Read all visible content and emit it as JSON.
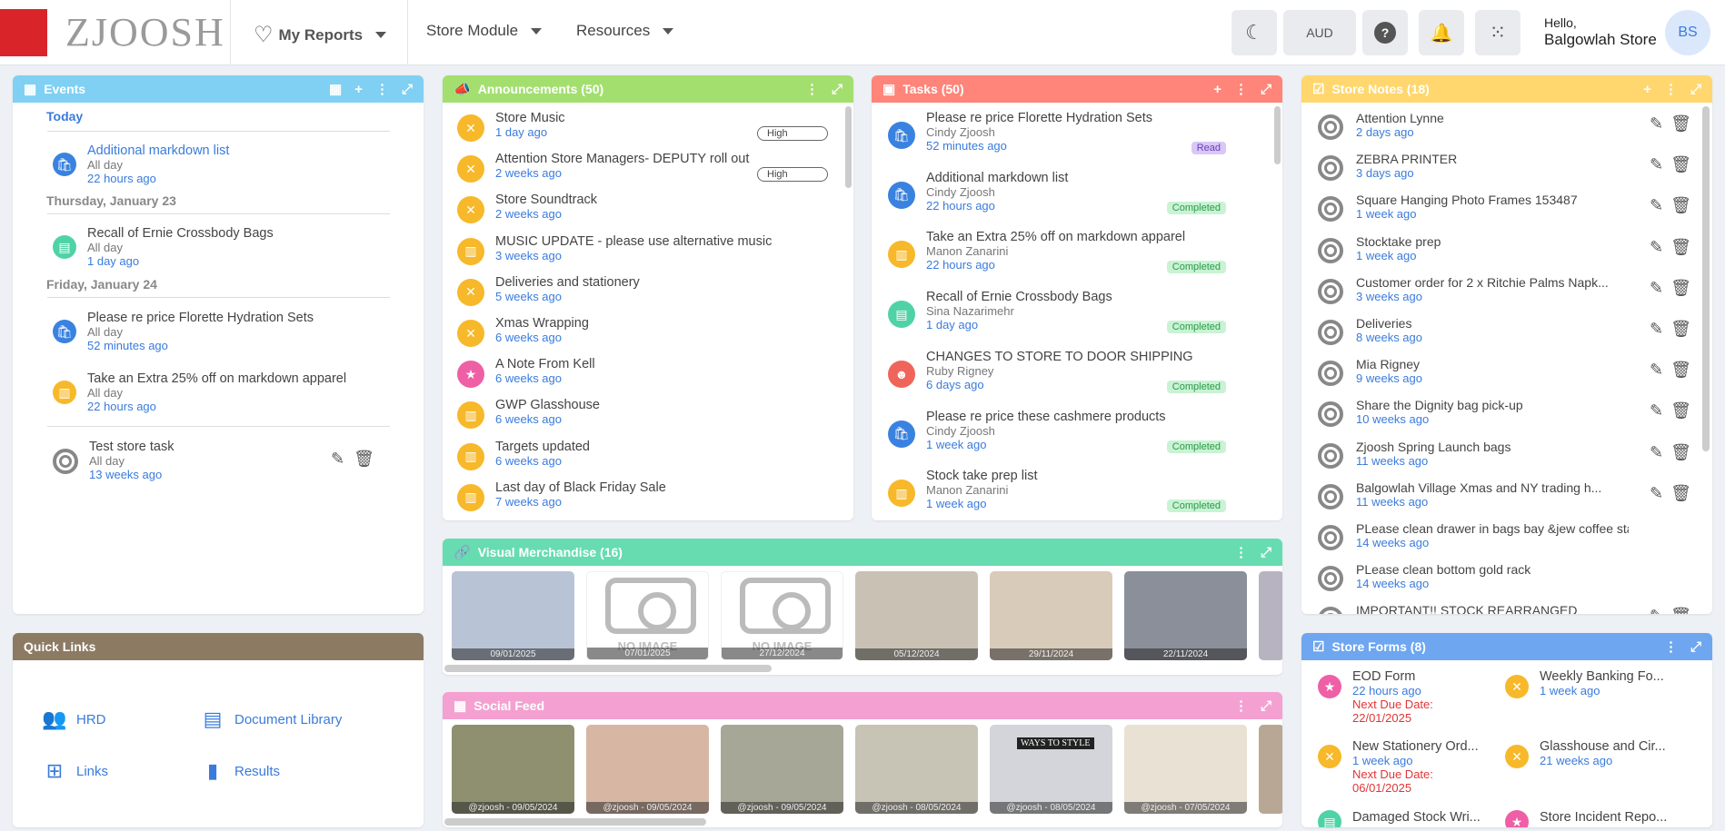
{
  "brand": {
    "name": "ZJOOSH",
    "logo_color": "#d9252a"
  },
  "nav": {
    "my_reports": "My Reports",
    "store_module": "Store Module",
    "resources": "Resources"
  },
  "toolbar": {
    "currency": "AUD"
  },
  "user": {
    "greeting": "Hello,",
    "store": "Balgowlah Store",
    "initials": "BS"
  },
  "events": {
    "title": "Events",
    "groups": [
      {
        "label": "Today",
        "items": [
          {
            "title": "Additional markdown list",
            "sub": "All day",
            "time": "22 hours ago"
          }
        ]
      },
      {
        "label": "Thursday, January 23",
        "items": [
          {
            "title": "Recall of Ernie Crossbody Bags",
            "sub": "All day",
            "time": "1 day ago"
          }
        ]
      },
      {
        "label": "Friday, January 24",
        "items": [
          {
            "title": "Please re price Florette Hydration Sets",
            "sub": "All day",
            "time": "52 minutes ago"
          },
          {
            "title": "Take an Extra 25% off on markdown apparel",
            "sub": "All day",
            "time": "22 hours ago"
          }
        ]
      }
    ],
    "task": {
      "title": "Test store task",
      "sub": "All day",
      "time": "13 weeks ago"
    }
  },
  "announcements": {
    "title": "Announcements (50)",
    "items": [
      {
        "title": "Store Music",
        "time": "1 day ago",
        "badge": "High"
      },
      {
        "title": "Attention Store Managers- DEPUTY roll out",
        "time": "2 weeks ago",
        "badge": "High"
      },
      {
        "title": "Store Soundtrack",
        "time": "2 weeks ago"
      },
      {
        "title": "MUSIC UPDATE - please use alternative music",
        "time": "3 weeks ago"
      },
      {
        "title": "Deliveries and stationery",
        "time": "5 weeks ago"
      },
      {
        "title": "Xmas Wrapping",
        "time": "6 weeks ago"
      },
      {
        "title": "A Note From Kell",
        "time": "6 weeks ago"
      },
      {
        "title": "GWP Glasshouse",
        "time": "6 weeks ago"
      },
      {
        "title": "Targets updated",
        "time": "6 weeks ago"
      },
      {
        "title": "Last day of Black Friday Sale",
        "time": "7 weeks ago"
      }
    ]
  },
  "tasks": {
    "title": "Tasks (50)",
    "items": [
      {
        "title": "Please re price Florette Hydration Sets",
        "person": "Cindy Zjoosh",
        "time": "52 minutes ago",
        "status": "Read"
      },
      {
        "title": "Additional markdown list",
        "person": "Cindy Zjoosh",
        "time": "22 hours ago",
        "status": "Completed"
      },
      {
        "title": "Take an Extra 25% off on markdown apparel",
        "person": "Manon Zanarini",
        "time": "22 hours ago",
        "status": "Completed"
      },
      {
        "title": "Recall of Ernie Crossbody Bags",
        "person": "Sina Nazarimehr",
        "time": "1 day ago",
        "status": "Completed"
      },
      {
        "title": "CHANGES TO STORE TO DOOR SHIPPING",
        "person": "Ruby Rigney",
        "time": "6 days ago",
        "status": "Completed"
      },
      {
        "title": "Please re price these cashmere products",
        "person": "Cindy Zjoosh",
        "time": "1 week ago",
        "status": "Completed"
      },
      {
        "title": "Stock take prep list",
        "person": "Manon Zanarini",
        "time": "1 week ago",
        "status": "Completed"
      }
    ]
  },
  "store_notes": {
    "title": "Store Notes (18)",
    "items": [
      {
        "title": "Attention Lynne",
        "time": "2 days ago"
      },
      {
        "title": "ZEBRA PRINTER",
        "time": "3 days ago"
      },
      {
        "title": "Square Hanging Photo Frames 153487",
        "time": "1 week ago"
      },
      {
        "title": "Stocktake prep",
        "time": "1 week ago"
      },
      {
        "title": "Customer order for 2 x Ritchie Palms Napk...",
        "time": "3 weeks ago"
      },
      {
        "title": "Deliveries",
        "time": "8 weeks ago"
      },
      {
        "title": "Mia Rigney",
        "time": "9 weeks ago"
      },
      {
        "title": "Share the Dignity bag pick-up",
        "time": "10 weeks ago"
      },
      {
        "title": "Zjoosh Spring Launch bags",
        "time": "11 weeks ago"
      },
      {
        "title": "Balgowlah Village Xmas and NY trading h...",
        "time": "11 weeks ago"
      },
      {
        "title": "PLease clean drawer in bags bay &jew coffee stain",
        "time": "14 weeks ago"
      },
      {
        "title": "PLease clean bottom gold rack",
        "time": "14 weeks ago"
      },
      {
        "title": "IMPORTANT!! STOCK REARRANGED",
        "time": ""
      }
    ]
  },
  "visual_merch": {
    "title": "Visual Merchandise (16)",
    "no_image": "NO IMAGE",
    "items": [
      {
        "date": "09/01/2025",
        "img": true,
        "color": "#b9c3d6"
      },
      {
        "date": "07/01/2025",
        "img": false
      },
      {
        "date": "27/12/2024",
        "img": false
      },
      {
        "date": "05/12/2024",
        "img": true,
        "color": "#c9c2b4"
      },
      {
        "date": "29/11/2024",
        "img": true,
        "color": "#d9cbb9"
      },
      {
        "date": "22/11/2024",
        "img": true,
        "color": "#8a8f9a"
      }
    ]
  },
  "social": {
    "title": "Social Feed",
    "items": [
      {
        "cap": "@zjoosh - 09/05/2024",
        "color": "#8f9070"
      },
      {
        "cap": "@zjoosh - 09/05/2024",
        "color": "#d7b7a4"
      },
      {
        "cap": "@zjoosh - 09/05/2024",
        "color": "#a6a797"
      },
      {
        "cap": "@zjoosh - 08/05/2024",
        "color": "#c7c3b5"
      },
      {
        "cap": "@zjoosh - 08/05/2024",
        "color": "#d3d5da",
        "text": "WAYS TO STYLE"
      },
      {
        "cap": "@zjoosh - 07/05/2024",
        "color": "#e8e1d4"
      }
    ]
  },
  "quick_links": {
    "title": "Quick Links",
    "items": [
      "HRD",
      "Document Library",
      "Links",
      "Results"
    ]
  },
  "store_forms": {
    "title": "Store Forms (8)",
    "items": [
      {
        "title": "EOD Form",
        "time": "22 hours ago",
        "due_label": "Next Due Date:",
        "due": "22/01/2025"
      },
      {
        "title": "Weekly Banking Fo...",
        "time": "1 week ago"
      },
      {
        "title": "New Stationery Ord...",
        "time": "1 week ago",
        "due_label": "Next Due Date:",
        "due": "06/01/2025"
      },
      {
        "title": "Glasshouse and Cir...",
        "time": "21 weeks ago"
      },
      {
        "title": "Damaged Stock Wri...",
        "time": ""
      },
      {
        "title": "Store Incident Repo...",
        "time": ""
      }
    ]
  },
  "colors": {
    "events": "#7fd0f2",
    "announcements": "#a3df6f",
    "tasks": "#ff8479",
    "notes": "#ffd76e",
    "visual": "#67dcb0",
    "social": "#f4a1d1",
    "quick": "#8c7a63",
    "forms": "#6ea6ef"
  }
}
